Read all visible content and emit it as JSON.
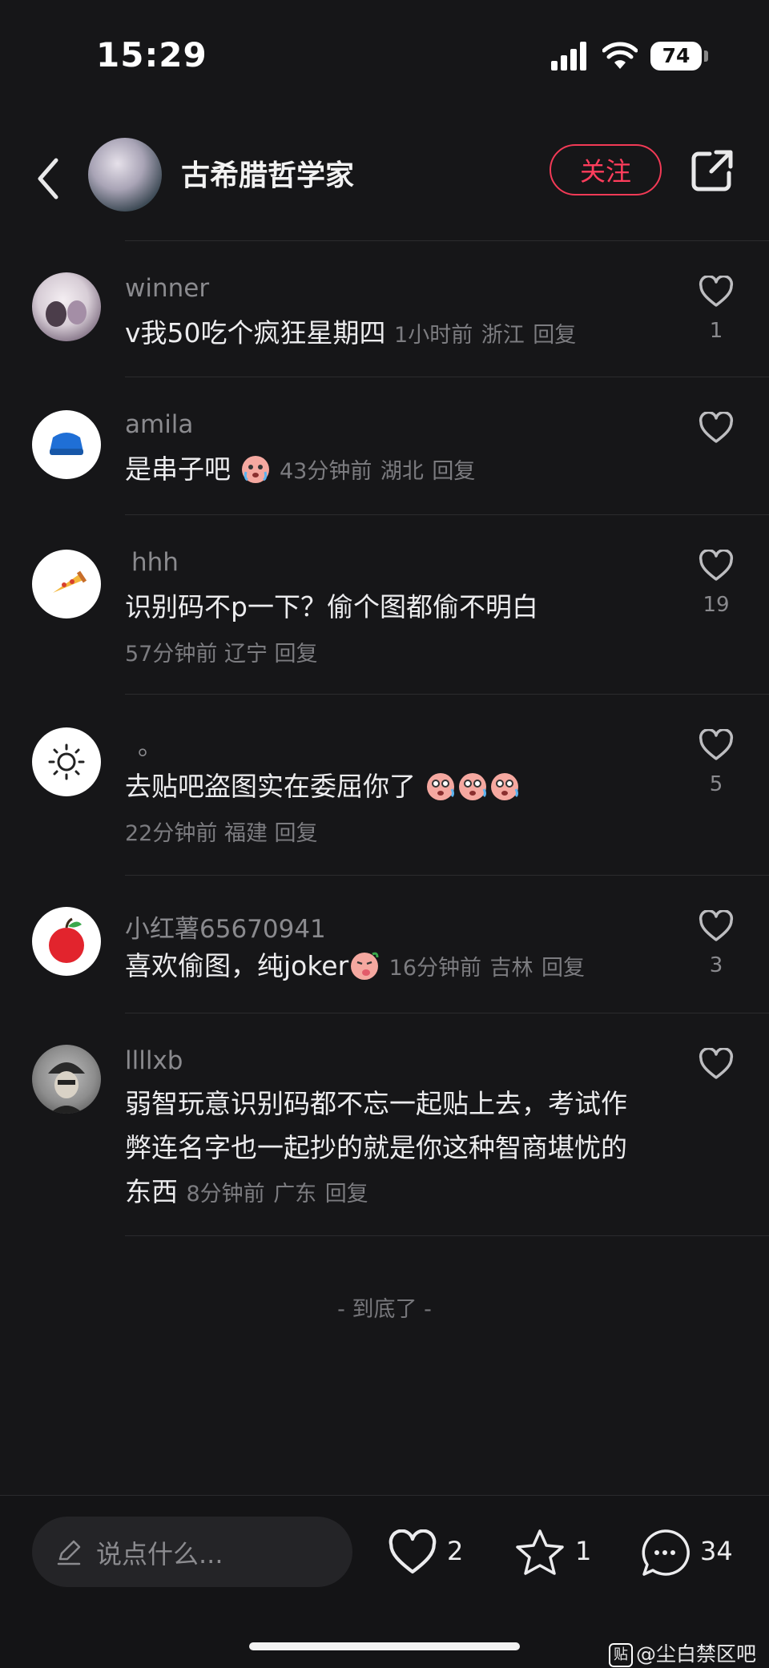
{
  "status_bar": {
    "time": "15:29",
    "battery": "74"
  },
  "header": {
    "author_name": "古希腊哲学家",
    "follow_label": "关注"
  },
  "comments": [
    {
      "username": "winner",
      "text": "v我50吃个疯狂星期四",
      "time": "1小时前",
      "location": "浙江",
      "reply": "回复",
      "likes": "1"
    },
    {
      "username": "amila",
      "text": "是串子吧",
      "time": "43分钟前",
      "location": "湖北",
      "reply": "回复",
      "likes": ""
    },
    {
      "username": "hhh",
      "text": "识别码不p一下？偷个图都偷不明白",
      "time": "57分钟前",
      "location": "辽宁",
      "reply": "回复",
      "likes": "19"
    },
    {
      "username": "。",
      "text": "去贴吧盗图实在委屈你了",
      "time": "22分钟前",
      "location": "福建",
      "reply": "回复",
      "likes": "5"
    },
    {
      "username": "小红薯65670941",
      "text": "喜欢偷图，纯joker",
      "time": "16分钟前",
      "location": "吉林",
      "reply": "回复",
      "likes": "3"
    },
    {
      "username": "llllxb",
      "text_line1": "弱智玩意识别码都不忘一起贴上去，考试作",
      "text_line2": "弊连名字也一起抄的就是你这种智商堪忧的",
      "text_line3": "东西",
      "time": "8分钟前",
      "location": "广东",
      "reply": "回复",
      "likes": ""
    }
  ],
  "end_text": "- 到底了 -",
  "bottom_bar": {
    "input_placeholder": "说点什么...",
    "likes": "2",
    "favorites": "1",
    "comments": "34"
  },
  "watermark": "@尘白禁区吧",
  "watermark_logo": "贴"
}
